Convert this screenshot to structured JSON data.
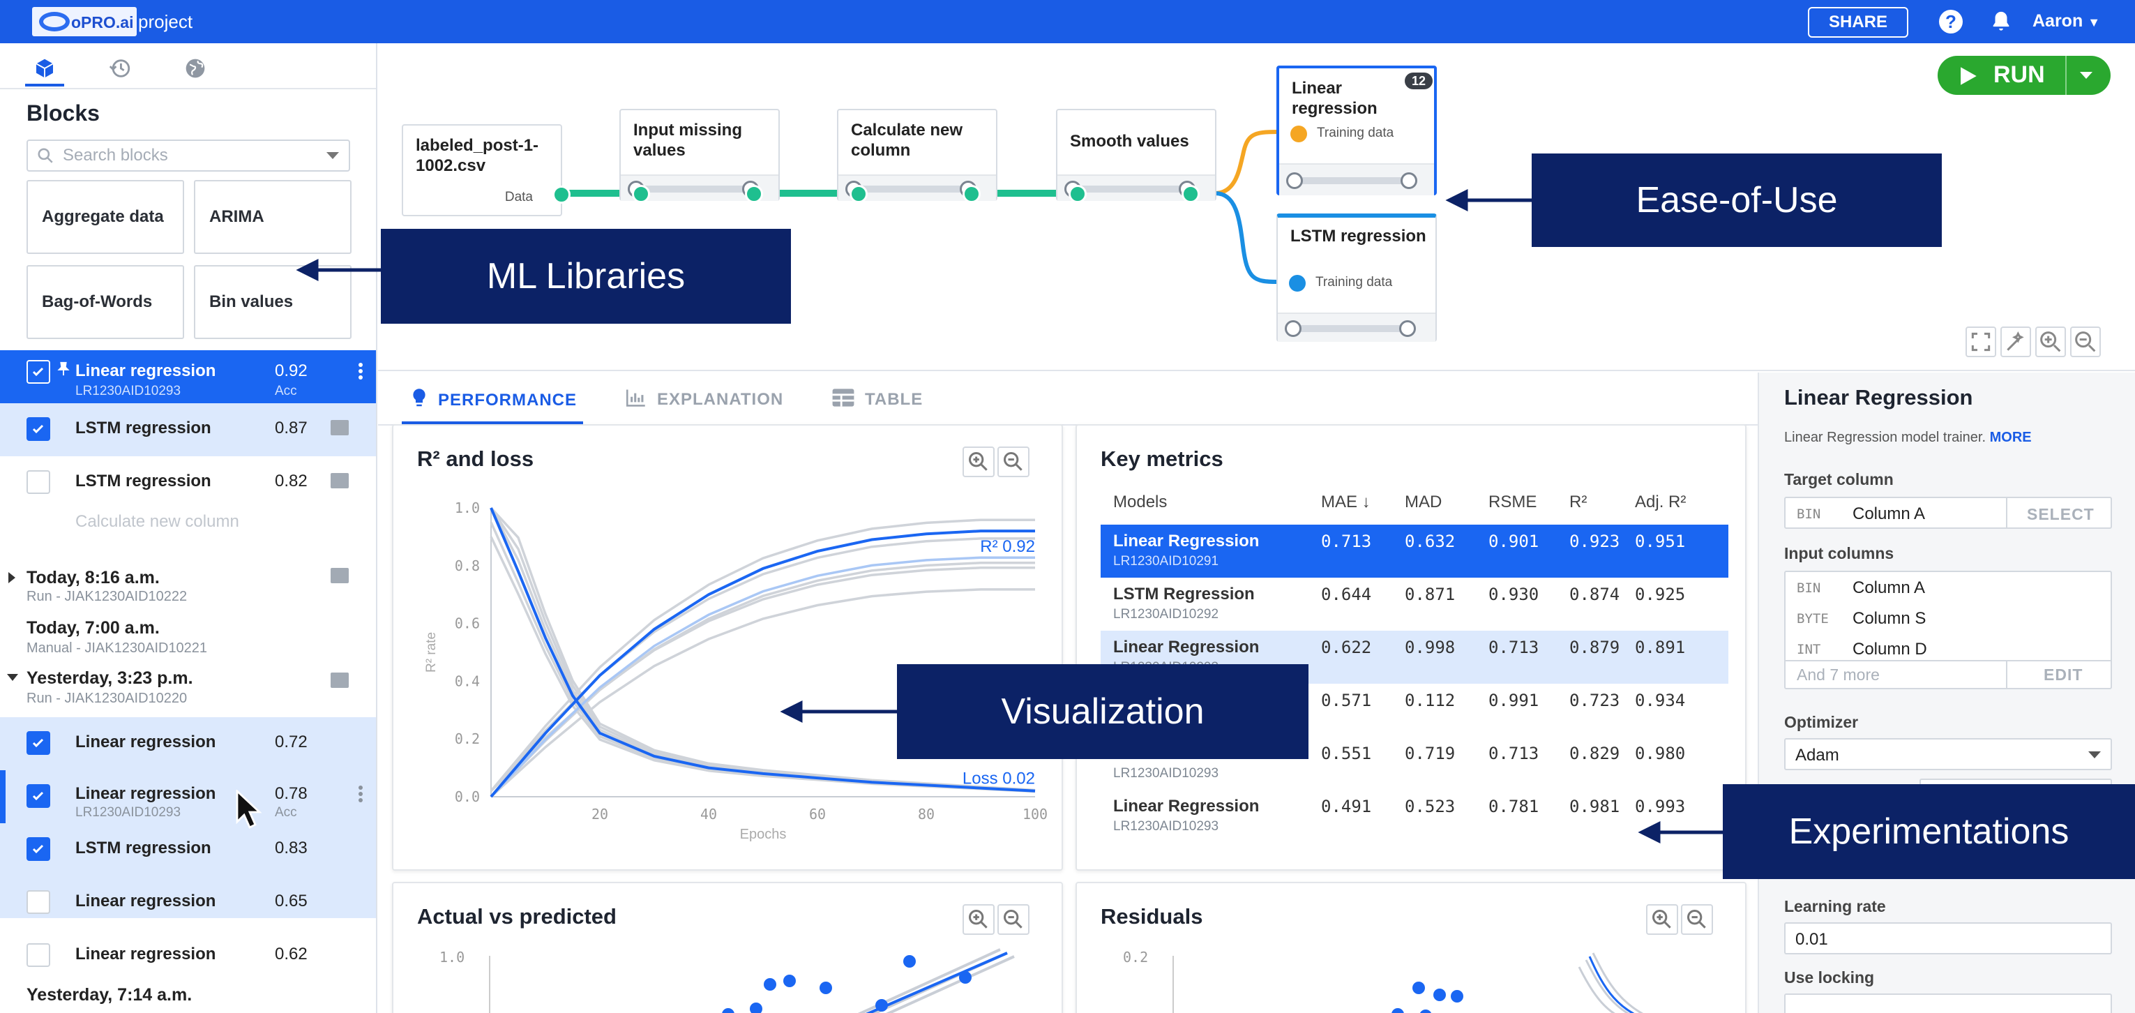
{
  "header": {
    "logo_text": "oPRO.ai",
    "project": "project",
    "share": "SHARE",
    "help": "?",
    "user": "Aaron"
  },
  "left": {
    "title": "Blocks",
    "search_placeholder": "Search blocks",
    "blocks": [
      "Aggregate data",
      "ARIMA",
      "Bag-of-Words",
      "Bin values"
    ],
    "runs": [
      {
        "name": "Linear regression",
        "id": "LR1230AID10293",
        "value": "0.92",
        "metric": "Acc"
      },
      {
        "name": "LSTM regression",
        "value": "0.87"
      },
      {
        "name": "LSTM regression",
        "value": "0.82"
      }
    ],
    "pending": "Calculate new column",
    "history": [
      {
        "title": "Today, 8:16 a.m.",
        "sub": "Run - JIAK1230AID10222"
      },
      {
        "title": "Today, 7:00 a.m.",
        "sub": "Manual - JIAK1230AID10221"
      },
      {
        "title": "Yesterday, 3:23 p.m.",
        "sub": "Run - JIAK1230AID10220"
      }
    ],
    "runs2": [
      {
        "name": "Linear regression",
        "value": "0.72"
      },
      {
        "name": "Linear regression",
        "id": "LR1230AID10293",
        "value": "0.78",
        "metric": "Acc"
      },
      {
        "name": "LSTM regression",
        "value": "0.83"
      },
      {
        "name": "Linear regression",
        "value": "0.65"
      },
      {
        "name": "Linear regression",
        "value": "0.62"
      }
    ],
    "last_history": "Yesterday, 7:14 a.m."
  },
  "canvas": {
    "run": "RUN",
    "nodes": [
      {
        "title": "labeled_post-1-1002.csv",
        "port": "Data"
      },
      {
        "title": "Input missing values"
      },
      {
        "title": "Calculate new column"
      },
      {
        "title": "Smooth values"
      },
      {
        "title": "Linear regression",
        "port": "Training data",
        "badge": "12"
      },
      {
        "title": "LSTM regression",
        "port": "Training data"
      }
    ]
  },
  "tabs": [
    "PERFORMANCE",
    "EXPLANATION",
    "TABLE"
  ],
  "r2chart": {
    "title": "R² and loss",
    "ylabel": "R² rate",
    "xlabel": "Epochs",
    "yticks": [
      "1.0",
      "0.8",
      "0.6",
      "0.4",
      "0.2",
      "0.0"
    ],
    "xticks": [
      "20",
      "40",
      "60",
      "80",
      "100"
    ],
    "r2_label": "R² 0.92",
    "loss_label": "Loss 0.02"
  },
  "chart_data": [
    {
      "type": "line",
      "title": "R² and loss",
      "xlabel": "Epochs",
      "ylabel": "R² rate",
      "xlim": [
        0,
        100
      ],
      "ylim": [
        0,
        1.0
      ],
      "series": [
        {
          "name": "R² 0.92",
          "color": "#1a66f2",
          "x": [
            0,
            10,
            20,
            30,
            40,
            50,
            60,
            70,
            80,
            90,
            100
          ],
          "y": [
            0.0,
            0.22,
            0.42,
            0.58,
            0.7,
            0.79,
            0.85,
            0.89,
            0.91,
            0.92,
            0.92
          ]
        },
        {
          "name": "Loss 0.02",
          "color": "#1a66f2",
          "x": [
            0,
            5,
            10,
            15,
            20,
            30,
            40,
            50,
            60,
            70,
            80,
            90,
            100
          ],
          "y": [
            1.0,
            0.78,
            0.55,
            0.35,
            0.22,
            0.14,
            0.1,
            0.08,
            0.065,
            0.05,
            0.04,
            0.03,
            0.02
          ]
        }
      ]
    },
    {
      "type": "table",
      "title": "Key metrics",
      "columns": [
        "Models",
        "MAE ↓",
        "MAD",
        "RSME",
        "R²",
        "Adj. R²"
      ],
      "rows": [
        {
          "name": "Linear Regression",
          "id": "LR1230AID10291",
          "vals": [
            "0.713",
            "0.632",
            "0.901",
            "0.923",
            "0.951"
          ]
        },
        {
          "name": "LSTM Regression",
          "id": "LR1230AID10292",
          "vals": [
            "0.644",
            "0.871",
            "0.930",
            "0.874",
            "0.925"
          ]
        },
        {
          "name": "Linear Regression",
          "id": "LR1230AID10293",
          "vals": [
            "0.622",
            "0.998",
            "0.713",
            "0.879",
            "0.891"
          ]
        },
        {
          "name": "",
          "id": "",
          "vals": [
            "0.571",
            "0.112",
            "0.991",
            "0.723",
            "0.934"
          ]
        },
        {
          "name": "",
          "id": "LR1230AID10293",
          "vals": [
            "0.551",
            "0.719",
            "0.713",
            "0.829",
            "0.980"
          ]
        },
        {
          "name": "Linear Regression",
          "id": "LR1230AID10293",
          "vals": [
            "0.491",
            "0.523",
            "0.781",
            "0.981",
            "0.993"
          ]
        }
      ]
    }
  ],
  "avp": {
    "title": "Actual vs predicted",
    "ytick": "1.0"
  },
  "resid": {
    "title": "Residuals",
    "ytick": "0.2"
  },
  "props": {
    "title": "Linear Regression",
    "desc": "Linear Regression model trainer.",
    "more": "MORE",
    "target_label": "Target column",
    "target_tag": "BIN",
    "target_val": "Column A",
    "select": "SELECT",
    "input_label": "Input columns",
    "inputs": [
      {
        "tag": "BIN",
        "val": "Column A"
      },
      {
        "tag": "BYTE",
        "val": "Column S"
      },
      {
        "tag": "INT",
        "val": "Column D"
      }
    ],
    "and_more": "And 7 more",
    "edit": "EDIT",
    "optimizer_label": "Optimizer",
    "optimizer": "Adam",
    "lr_label": "Learning rate",
    "lr": "0.01",
    "lock_label": "Use locking"
  },
  "callouts": {
    "ml": "ML Libraries",
    "ease": "Ease-of-Use",
    "vis": "Visualization",
    "exp": "Experimentations"
  },
  "colors": {
    "topbar": "#1a5ce5",
    "accent": "#1a66f2",
    "run": "#2aa82f",
    "teal": "#1fbf8f",
    "orange": "#f5a623",
    "callout": "#0c2266"
  }
}
